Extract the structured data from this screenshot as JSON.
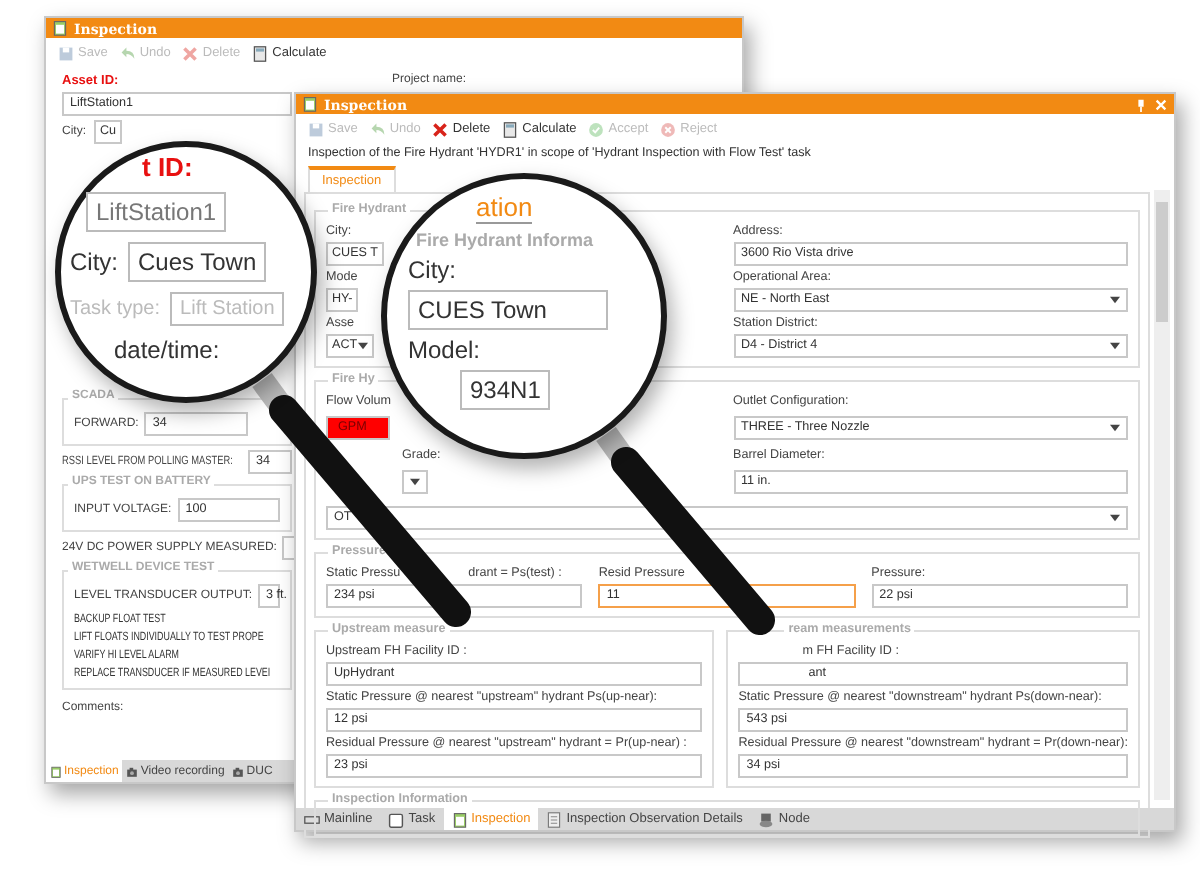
{
  "back_window": {
    "title": "Inspection",
    "toolbar": [
      {
        "label": "Save",
        "kind": "save",
        "disabled": true
      },
      {
        "label": "Undo",
        "kind": "undo",
        "disabled": true
      },
      {
        "label": "Delete",
        "kind": "delete",
        "disabled": true
      },
      {
        "label": "Calculate",
        "kind": "calculate",
        "disabled": false
      }
    ],
    "asset_id_label": "Asset ID:",
    "asset_id": "LiftStation1",
    "project_name_label": "Project name:",
    "city_label": "City:",
    "city_value": "Cu",
    "scada_group": "SCADA",
    "forward_label": "FORWARD:",
    "forward_value": "34",
    "rssi_label": "RSSI LEVEL FROM POLLING MASTER:",
    "rssi_value": "34",
    "ups_group": "UPS TEST ON BATTERY",
    "input_voltage_label": "INPUT VOLTAGE:",
    "input_voltage_value": "100",
    "power_label": "24V DC POWER SUPPLY MEASURED:",
    "wetwell_group": "WETWELL DEVICE TEST",
    "level_label": "LEVEL TRANSDUCER OUTPUT:",
    "level_value": "3 ft.",
    "checks": [
      "BACKUP FLOAT TEST",
      "LIFT FLOATS INDIVIDUALLY TO TEST PROPE",
      "VARIFY HI LEVEL ALARM",
      "REPLACE TRANSDUCER IF MEASURED LEVEI"
    ],
    "comments_label": "Comments:",
    "tabs": [
      {
        "label": "Inspection",
        "kind": "form",
        "selected": true
      },
      {
        "label": "Video recording",
        "kind": "camera",
        "selected": false
      },
      {
        "label": "DUC",
        "kind": "camera",
        "selected": false
      }
    ]
  },
  "front_window": {
    "title": "Inspection",
    "toolbar": [
      {
        "label": "Save",
        "kind": "save",
        "disabled": true
      },
      {
        "label": "Undo",
        "kind": "undo",
        "disabled": true
      },
      {
        "label": "Delete",
        "kind": "delete",
        "disabled": false
      },
      {
        "label": "Calculate",
        "kind": "calculate",
        "disabled": false
      },
      {
        "label": "Accept",
        "kind": "accept",
        "disabled": true
      },
      {
        "label": "Reject",
        "kind": "reject",
        "disabled": true
      }
    ],
    "description": "Inspection of the Fire Hydrant 'HYDR1' in scope of 'Hydrant Inspection with Flow Test' task",
    "tabs": [
      {
        "label": "Inspection",
        "selected": true
      }
    ],
    "hydrant_group": {
      "title": "Fire Hydrant",
      "left": [
        {
          "label": "City:",
          "value": "CUES T"
        },
        {
          "label": "Mode",
          "value": "HY-"
        },
        {
          "label": "Asse",
          "value": "ACT",
          "kind": "select"
        }
      ],
      "right": [
        {
          "label": "Address:",
          "value": "3600 Rio Vista drive",
          "kind": "text"
        },
        {
          "label": "Operational Area:",
          "value": "NE - North East",
          "kind": "select"
        },
        {
          "label": "Station District:",
          "value": "D4 - District 4",
          "kind": "select"
        }
      ]
    },
    "flow_group": {
      "title": "Fire Hy",
      "left": [
        {
          "label": "Flow Volum",
          "value": "GPM",
          "kind": "text",
          "error": true
        },
        {
          "label": "Grade:",
          "kind": "select",
          "error": false
        }
      ],
      "right": [
        {
          "label": "Outlet Configuration:",
          "value": "THREE - Three Nozzle",
          "kind": "select",
          "error": false
        },
        {
          "label": "Barrel Diameter:",
          "value": "11 in.",
          "kind": "text",
          "error": false
        }
      ],
      "full": {
        "value": "OT",
        "kind": "select"
      }
    },
    "pressure_group": {
      "title": "Pressure",
      "fields": [
        {
          "label": "Static Pressu",
          "label_end": "drant = Ps(test) :",
          "value": "234 psi",
          "focused": false
        },
        {
          "label": "Resid Pressure",
          "value": "11",
          "focused": true
        },
        {
          "label": "Pressure:",
          "value": "22 psi",
          "focused": false
        }
      ]
    },
    "upstream_group": {
      "title": "Upstream measure",
      "fields": [
        {
          "label": "Upstream FH Facility ID :",
          "value": "UpHydrant"
        },
        {
          "label": "Static Pressure @ nearest \"upstream\" hydrant Ps(up-near):",
          "value": "12 psi"
        },
        {
          "label": "Residual Pressure @ nearest \"upstream\" hydrant = Pr(up-near) :",
          "value": "23 psi"
        }
      ]
    },
    "downstream_group": {
      "title": "ream measurements",
      "fields": [
        {
          "label": "m FH Facility ID :",
          "value": "ant"
        },
        {
          "label": "Static Pressure @ nearest \"downstream\" hydrant Ps(down-near):",
          "value": "543 psi"
        },
        {
          "label": "Residual Pressure @ nearest \"downstream\" hydrant = Pr(down-near):",
          "value": "34 psi"
        }
      ]
    },
    "info_group": {
      "title": "Inspection Information"
    },
    "bottom_tabs": [
      {
        "label": "Mainline",
        "kind": "pipe",
        "selected": false
      },
      {
        "label": "Task",
        "kind": "task",
        "selected": false
      },
      {
        "label": "Inspection",
        "kind": "form",
        "selected": true
      },
      {
        "label": "Inspection Observation Details",
        "kind": "doc",
        "selected": false
      },
      {
        "label": "Node",
        "kind": "node",
        "selected": false
      }
    ]
  },
  "lens_left": {
    "asset_label": "t ID:",
    "asset_value": "LiftStation1",
    "city_label": "City:",
    "city_value": "Cues Town",
    "task_label": "Task type:",
    "task_value": "Lift Station",
    "date_label": "date/time:"
  },
  "lens_right": {
    "tab_label": "ation",
    "group_title": "Fire Hydrant Informa",
    "city_label": "City:",
    "city_value": "CUES Town",
    "model_label": "Model:",
    "model_value": "934N1"
  }
}
